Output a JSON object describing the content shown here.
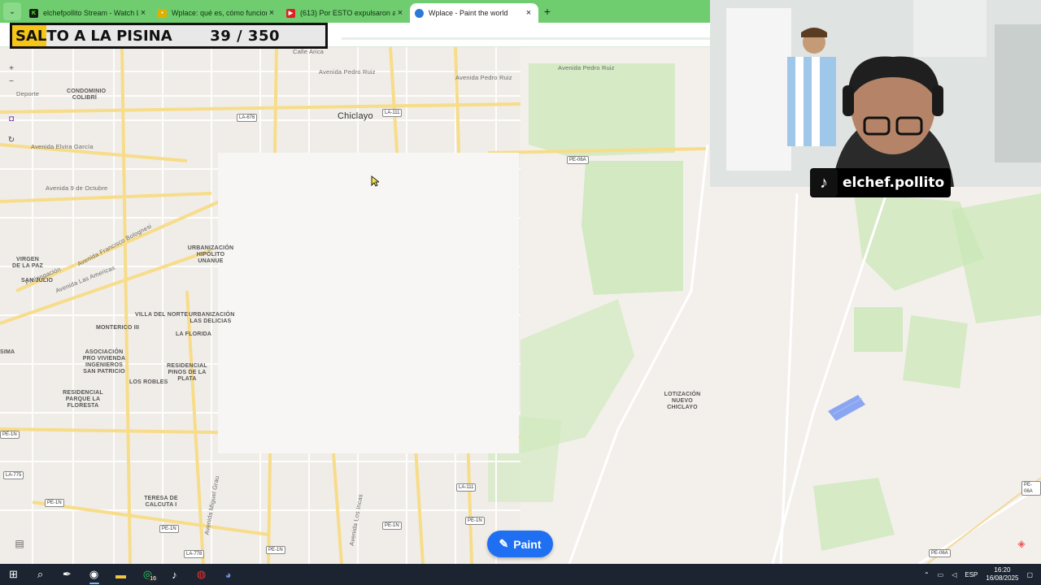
{
  "browser": {
    "tabs": [
      {
        "title": "elchefpollito Stream - Watch Li",
        "favicon": "kick-icon",
        "color": "#1a1a1a",
        "active": false
      },
      {
        "title": "Wplace: qué es, cómo funciona",
        "favicon": "news-icon",
        "color": "#e0b000",
        "active": false
      },
      {
        "title": "(613) Por ESTO expulsaron a RI",
        "favicon": "youtube-icon",
        "color": "#e02020",
        "active": false
      },
      {
        "title": "Wplace - Paint the world",
        "favicon": "globe-icon",
        "color": "#2a7ad6",
        "active": true
      }
    ],
    "new_tab_label": "+",
    "tab_close_label": "×"
  },
  "overlay": {
    "highlight": "SAL",
    "rest": "TO A LA PISINA",
    "counter": "39 / 350"
  },
  "map": {
    "city": "Chiclayo",
    "streets": [
      "Calle Arica",
      "Avenida Pedro Ruiz",
      "Avenida Pedro Ruiz",
      "Avenida Pedro Ruiz",
      "Deporte",
      "Avenida Elvira García",
      "Avenida 9 de Octubre",
      "Avenida Francisco Bolognesi",
      "Avenida Las Americas",
      "Prolongación",
      "Avenida Miguel Grau",
      "Avenida Los Incas"
    ],
    "districts": [
      "CONDOMINIO COLIBRÍ",
      "URBANIZACIÓN HIPÓLITO UNANUE",
      "VIRGEN DE LA PAZ",
      "SAN JULIO",
      "VILLA DEL NORTE",
      "URBANIZACIÓN LAS DELICIAS",
      "MONTERICO III",
      "LA FLORIDA",
      "ASOCIACIÓN PRO VIVIENDA INGENIEROS SAN PATRICIO",
      "RESIDENCIAL PINOS DE LA PLATA",
      "LOS ROBLES",
      "RESIDENCIAL PARQUE LA FLORESTA",
      "SIMA",
      "TERESA DE CALCUTA I",
      "LOTIZACIÓN NUEVO CHICLAYO"
    ],
    "shields": [
      "LA-676",
      "LA-111",
      "PE-06A",
      "PE-1N",
      "LA-775",
      "PE-1N",
      "LA-111",
      "PE-1N",
      "PE-1N",
      "PE-1N",
      "LA-778",
      "PE-1N",
      "PE-06A",
      "PE-06A"
    ]
  },
  "stream": {
    "tiktok_handle": "elchef.pollito"
  },
  "paint_button": {
    "label": "Paint",
    "color": "#1f6ff2"
  },
  "taskbar": {
    "time": "16:20",
    "date": "16/08/2025",
    "lang": "ESP",
    "whatsapp_badge": "16"
  }
}
